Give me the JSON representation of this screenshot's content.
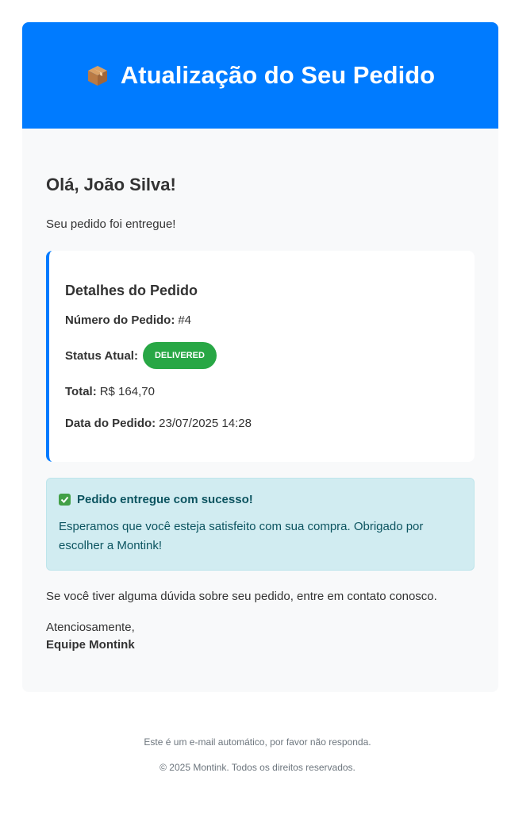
{
  "header": {
    "title": "Atualização do Seu Pedido",
    "icon": "package-icon",
    "color": "#007bff"
  },
  "greeting": "Olá, João Silva!",
  "intro": "Seu pedido foi entregue!",
  "details": {
    "title": "Detalhes do Pedido",
    "order_number_label": "Número do Pedido:",
    "order_number": "#4",
    "status_label": "Status Atual:",
    "status_badge": "DELIVERED",
    "total_label": "Total:",
    "total": "R$ 164,70",
    "date_label": "Data do Pedido:",
    "date": "23/07/2025 14:28"
  },
  "alert": {
    "title": "Pedido entregue com sucesso!",
    "icon": "check-icon",
    "body": "Esperamos que você esteja satisfeito com sua compra. Obrigado por escolher a Montink!"
  },
  "contact_note": "Se você tiver alguma dúvida sobre seu pedido, entre em contato conosco.",
  "signoff": {
    "closing": "Atenciosamente,",
    "team": "Equipe Montink"
  },
  "footer": {
    "auto_notice": "Este é um e-mail automático, por favor não responda.",
    "copyright": "© 2025 Montink. Todos os direitos reservados."
  },
  "colors": {
    "accent": "#007bff",
    "success": "#28a745",
    "alert_bg": "#d1ecf1",
    "alert_text": "#0c5460"
  }
}
